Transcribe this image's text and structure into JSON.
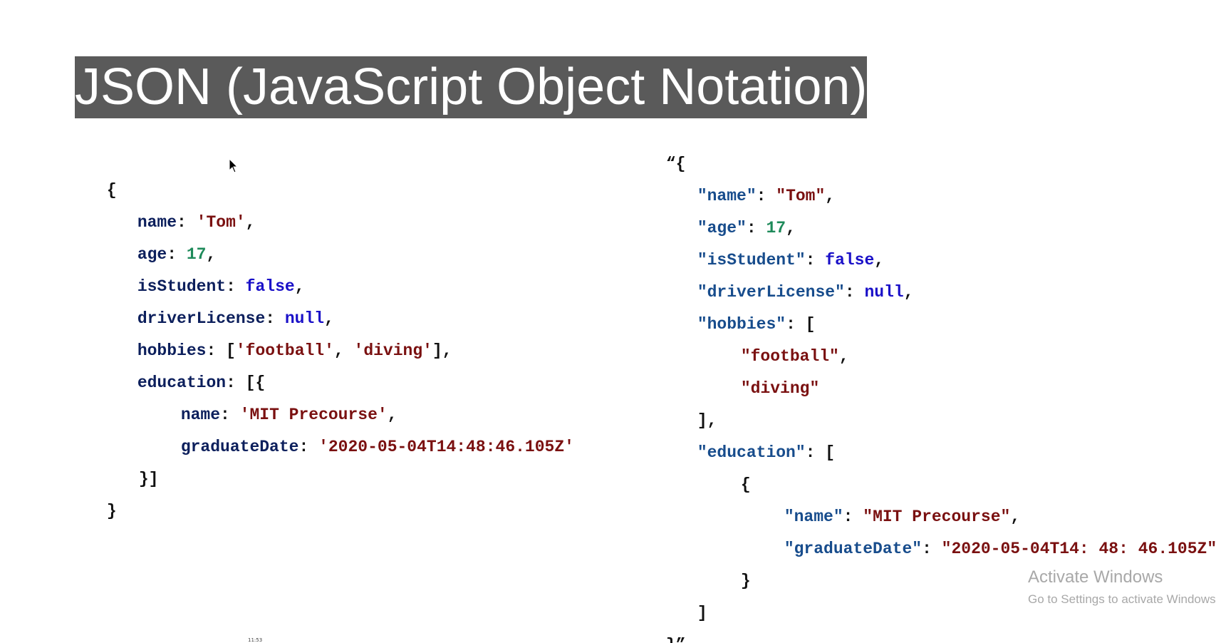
{
  "title": "JSON (JavaScript Object Notation)",
  "left_object": {
    "open": "{",
    "close": "}",
    "name_key": "name",
    "name_value": "'Tom'",
    "age_key": "age",
    "age_value": "17",
    "isStudent_key": "isStudent",
    "isStudent_value": "false",
    "driverLicense_key": "driverLicense",
    "driverLicense_value": "null",
    "hobbies_key": "hobbies",
    "hobby_1": "'football'",
    "hobby_2": "'diving'",
    "education_key": "education",
    "edu_name_key": "name",
    "edu_name_value": "'MIT Precourse'",
    "edu_date_key": "graduateDate",
    "edu_date_value": "'2020-05-04T14:48:46.105Z'",
    "edu_close": "}]"
  },
  "right_json": {
    "open": "“{",
    "close": "}”",
    "name_key": "\"name\"",
    "name_value": "\"Tom\"",
    "age_key": "\"age\"",
    "age_value": "17",
    "isStudent_key": "\"isStudent\"",
    "isStudent_value": "false",
    "driverLicense_key": "\"driverLicense\"",
    "driverLicense_value": "null",
    "hobbies_key": "\"hobbies\"",
    "hobby_1": "\"football\"",
    "hobby_2": "\"diving\"",
    "education_key": "\"education\"",
    "edu_name_key": "\"name\"",
    "edu_name_value": "\"MIT Precourse\"",
    "edu_date_key": "\"graduateDate\"",
    "edu_date_value": "\"2020-05-04T14: 48: 46.105Z\""
  },
  "watermark": {
    "line1": "Activate Windows",
    "line2": "Go to Settings to activate Windows."
  },
  "footer_tiny": "11:53",
  "colors": {
    "title_bg": "#5a5a5a",
    "key": "#0c1f5c",
    "string": "#7a1010",
    "number": "#1e8a5a",
    "keyword": "#1a10c8"
  }
}
